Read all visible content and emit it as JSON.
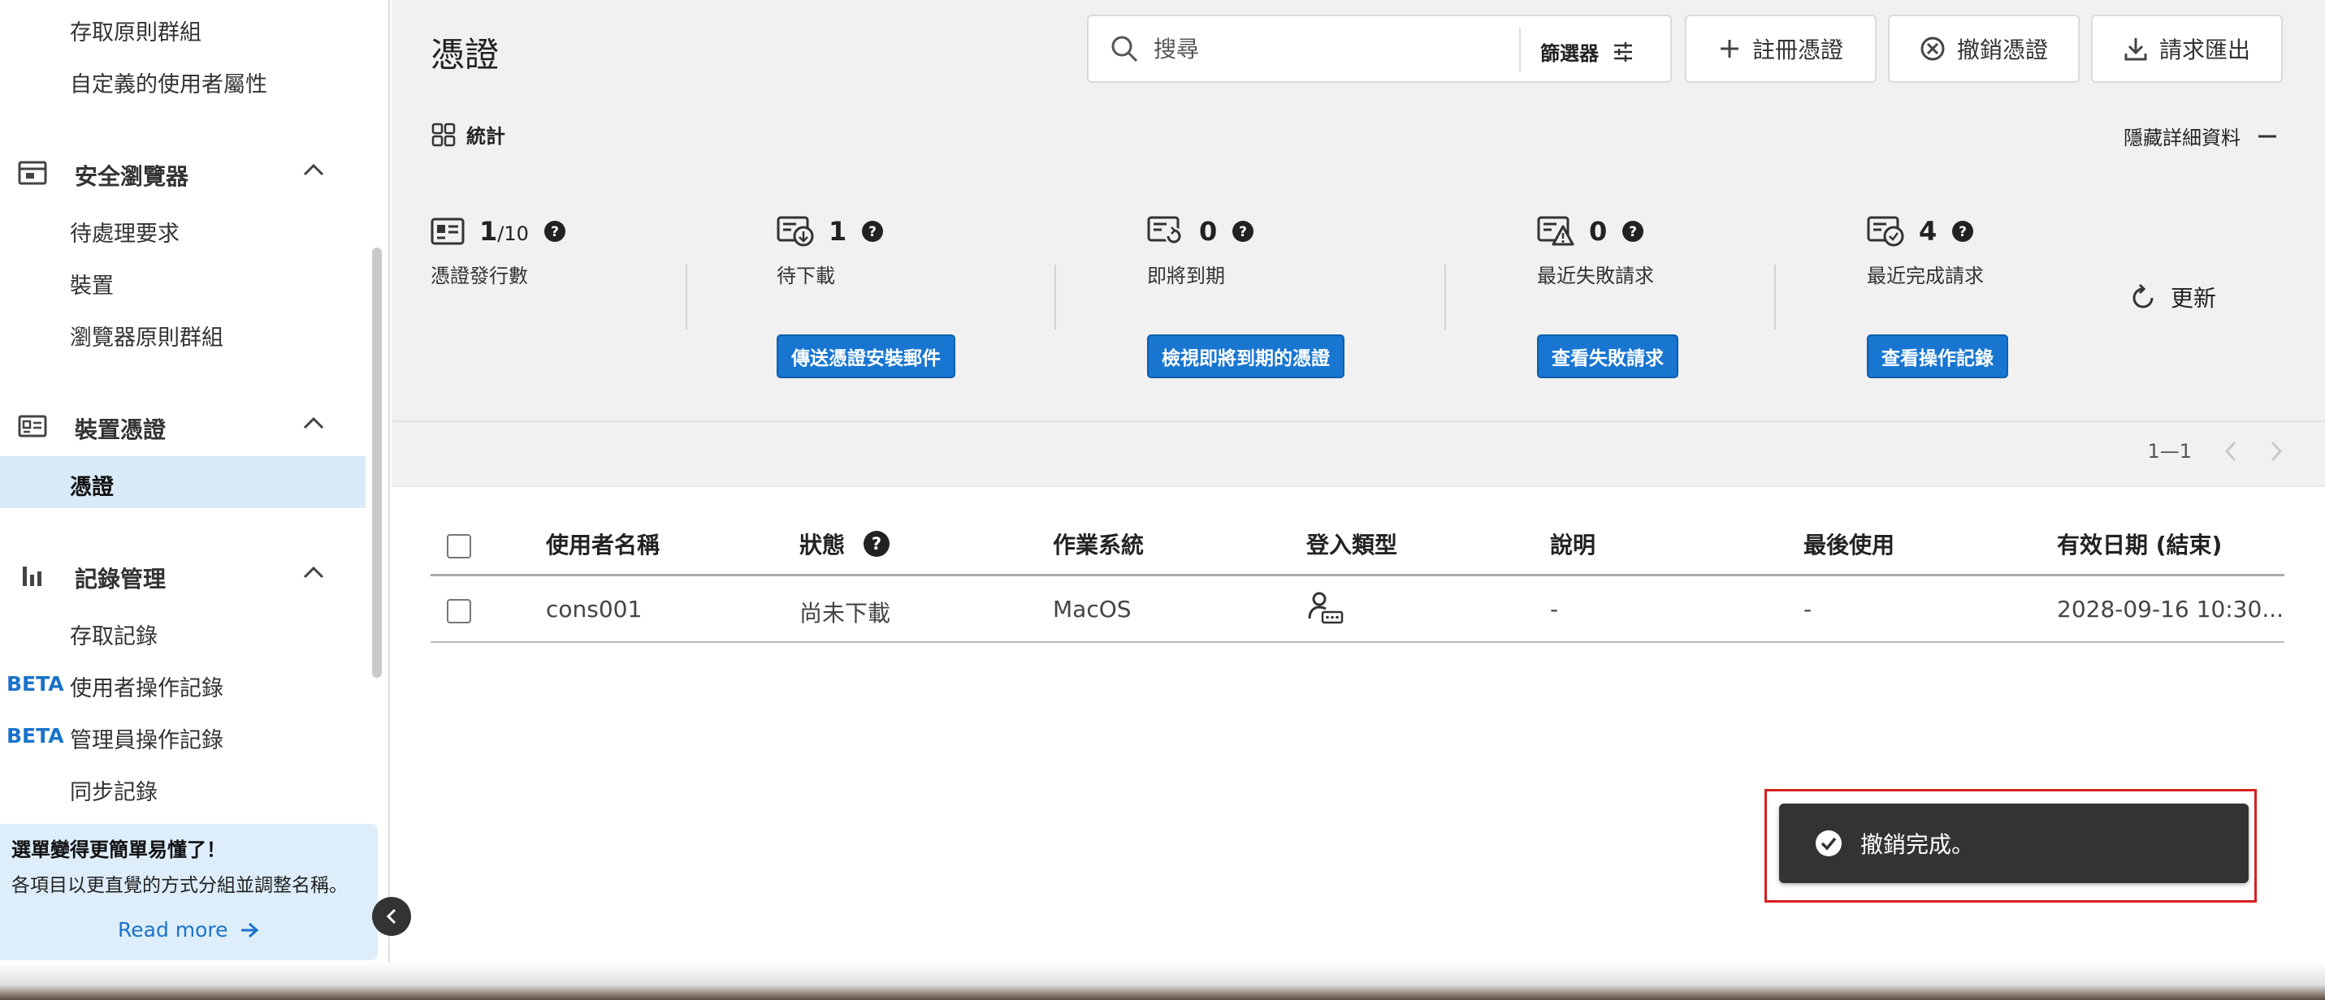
{
  "sidebar": {
    "top_items": [
      "存取原則群組",
      "自定義的使用者屬性"
    ],
    "groups": [
      {
        "label": "安全瀏覽器",
        "items": [
          "待處理要求",
          "裝置",
          "瀏覽器原則群組"
        ]
      },
      {
        "label": "裝置憑證",
        "items": [
          "憑證"
        ]
      },
      {
        "label": "記錄管理",
        "items": [
          "存取記錄",
          "使用者操作記錄",
          "管理員操作記錄",
          "同步記錄"
        ]
      }
    ],
    "beta_label": "BETA",
    "active_item": "憑證"
  },
  "banner": {
    "title": "選單變得更簡單易懂了！",
    "body": "各項目以更直覺的方式分組並調整名稱。",
    "read_more": "Read more"
  },
  "header": {
    "title": "憑證",
    "search_placeholder": "搜尋",
    "filter_label": "篩選器",
    "register_label": "註冊憑證",
    "revoke_label": "撤銷憑證",
    "export_label": "請求匯出"
  },
  "stats": {
    "section_label": "統計",
    "hide_label": "隱藏詳細資料",
    "refresh_label": "更新",
    "issued": {
      "value": "1",
      "total": "/10",
      "label": "憑證發行數"
    },
    "pending": {
      "value": "1",
      "label": "待下載",
      "action": "傳送憑證安裝郵件"
    },
    "expiring": {
      "value": "0",
      "label": "即將到期",
      "action": "檢視即將到期的憑證"
    },
    "failed": {
      "value": "0",
      "label": "最近失敗請求",
      "action": "查看失敗請求"
    },
    "completed": {
      "value": "4",
      "label": "最近完成請求",
      "action": "查看操作記錄"
    }
  },
  "pager": {
    "range": "1—1",
    "prev": "‹",
    "next": "›"
  },
  "table": {
    "columns": [
      "使用者名稱",
      "狀態",
      "作業系統",
      "登入類型",
      "說明",
      "最後使用",
      "有效日期 (結束)"
    ],
    "rows": [
      {
        "user": "cons001",
        "status": "尚未下載",
        "os": "MacOS",
        "login_icon": "user-password-icon",
        "desc": "-",
        "last_used": "-",
        "expiry": "2028-09-16 10:30..."
      }
    ]
  },
  "toast": {
    "message": "撤銷完成。"
  },
  "colors": {
    "accent": "#1876d1",
    "toast_bg": "#333333",
    "highlight": "#d9201f",
    "active_bg": "#d9eaf9"
  }
}
